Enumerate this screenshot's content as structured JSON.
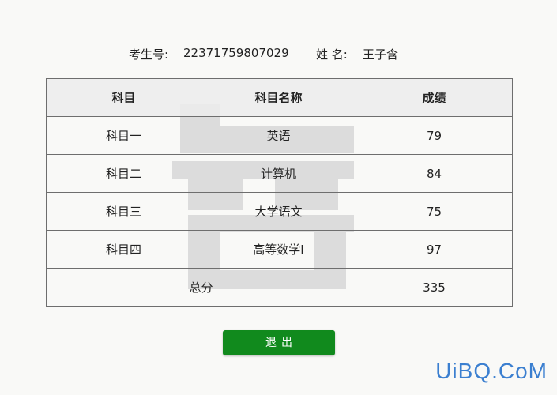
{
  "header": {
    "exam_id_label": "考生号:",
    "exam_id_value": "22371759807029",
    "name_label": "姓 名:",
    "name_value": "王子含"
  },
  "table": {
    "columns": [
      "科目",
      "科目名称",
      "成绩"
    ],
    "rows": [
      {
        "subject": "科目一",
        "name": "英语",
        "score": "79"
      },
      {
        "subject": "科目二",
        "name": "计算机",
        "score": "84"
      },
      {
        "subject": "科目三",
        "name": "大学语文",
        "score": "75"
      },
      {
        "subject": "科目四",
        "name": "高等数学Ⅰ",
        "score": "97"
      }
    ],
    "total_label": "总分",
    "total_value": "335"
  },
  "exit_button_label": "退出",
  "brand_watermark": "UiBQ.CoM",
  "colors": {
    "button": "#118a1d",
    "brand": "#3b7fd0",
    "header_bg": "#ececec"
  }
}
